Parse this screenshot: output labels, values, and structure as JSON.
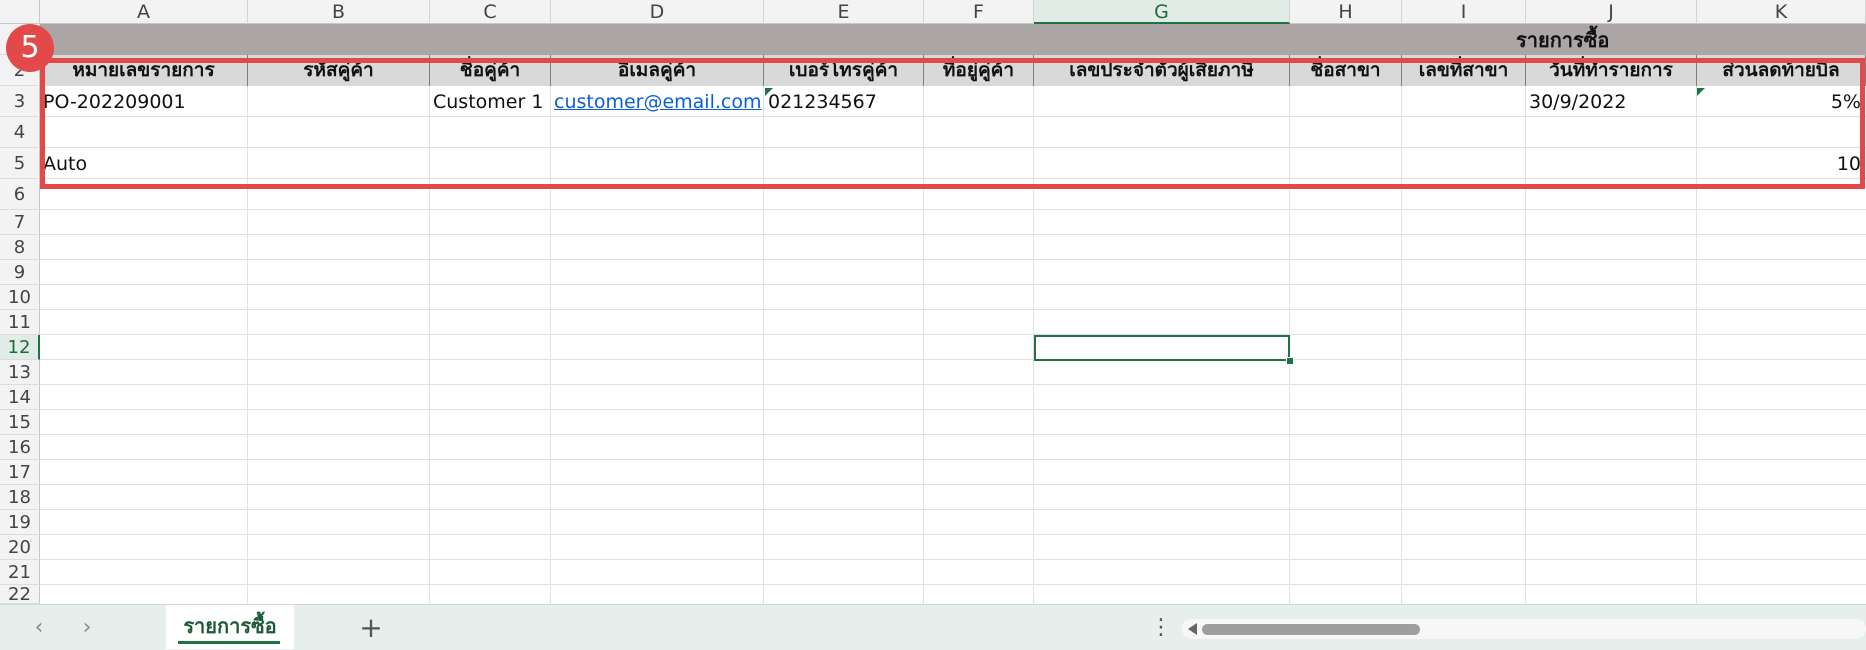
{
  "sheet": {
    "columns": [
      "A",
      "B",
      "C",
      "D",
      "E",
      "F",
      "G",
      "H",
      "I",
      "J",
      "K"
    ],
    "rows": [
      "1",
      "2",
      "3",
      "4",
      "5",
      "6",
      "7",
      "8",
      "9",
      "10",
      "11",
      "12",
      "13",
      "14",
      "15",
      "16",
      "17",
      "18",
      "19",
      "20",
      "21",
      "22"
    ],
    "title": "รายการซื้อ",
    "headers": [
      "หมายเลขรายการ",
      "รหัสคู่ค้า",
      "ชื่อคู่ค้า",
      "อีเมลคู่ค้า",
      "เบอร์โทรคู่ค้า",
      "ที่อยู่คู่ค้า",
      "เลขประจำตัวผู้เสียภาษี",
      "ชื่อสาขา",
      "เลขที่สาขา",
      "วันที่ทำรายการ",
      "ส่วนลดท้ายบิล"
    ],
    "row3": {
      "order_number": "PO-202209001",
      "customer_name": "Customer 1",
      "email": "customer@email.com",
      "phone": "021234567",
      "date": "30/9/2022",
      "discount": "5%"
    },
    "row5": {
      "order_number": "Auto",
      "discount": "10"
    },
    "selected_cell": "G12"
  },
  "annotation": {
    "badge": "5"
  },
  "tabs": [
    {
      "label": "รายการซื้อ",
      "active": true
    }
  ],
  "colors": {
    "accent": "#1f7244",
    "highlight": "#e24a4a",
    "title_band": "#aba5a5"
  }
}
